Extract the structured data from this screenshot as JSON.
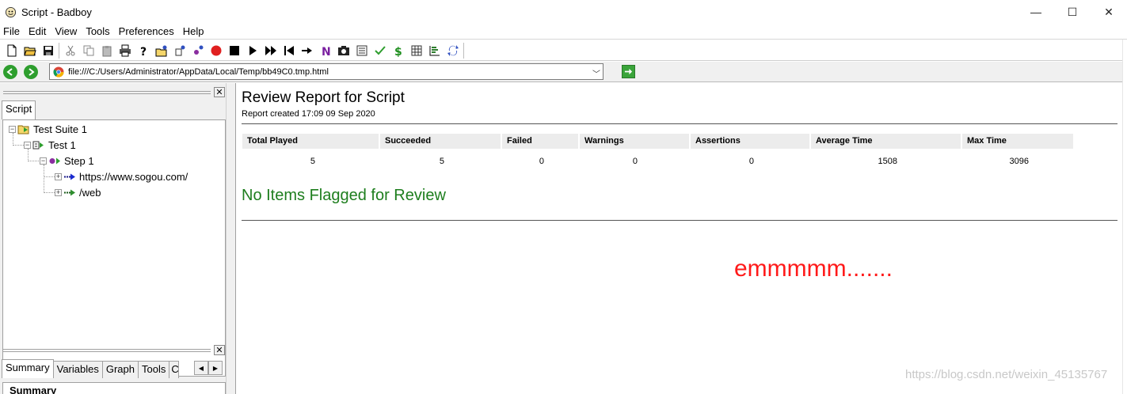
{
  "window": {
    "title": "Script - Badboy",
    "minimize": "—",
    "maximize": "☐",
    "close": "✕"
  },
  "menu": [
    "File",
    "Edit",
    "View",
    "Tools",
    "Preferences",
    "Help"
  ],
  "toolbar": {
    "icons": [
      "new-icon",
      "open-icon",
      "save-icon",
      "cut-icon",
      "copy-icon",
      "paste-icon",
      "print-icon",
      "help-icon",
      "add-suite-icon",
      "add-test-icon",
      "add-step-icon",
      "record-icon",
      "stop-icon",
      "play-icon",
      "play-all-icon",
      "rewind-icon",
      "step-icon",
      "navigation-icon",
      "screenshot-icon",
      "form-icon",
      "assertion-icon",
      "variable-icon",
      "table-icon",
      "report-icon",
      "refresh-icon"
    ]
  },
  "address": {
    "url": "file:///C:/Users/Administrator/AppData/Local/Temp/bb49C0.tmp.html"
  },
  "left_panel": {
    "top_tab": "Script",
    "tree": [
      {
        "label": "Test Suite 1",
        "level": 0
      },
      {
        "label": "Test 1",
        "level": 1
      },
      {
        "label": "Step 1",
        "level": 2
      },
      {
        "label": "https://www.sogou.com/",
        "level": 3
      },
      {
        "label": "/web",
        "level": 3
      }
    ],
    "bottom_tabs": [
      "Summary",
      "Variables",
      "Graph",
      "Tools",
      "C"
    ],
    "summary_heading": "Summary"
  },
  "report": {
    "title": "Review Report for Script",
    "subtitle": "Report created 17:09 09 Sep 2020",
    "columns": [
      "Total Played",
      "Succeeded",
      "Failed",
      "Warnings",
      "Assertions",
      "Average Time",
      "Max Time"
    ],
    "values": [
      "5",
      "5",
      "0",
      "0",
      "0",
      "1508",
      "3096"
    ],
    "flagged": "No Items Flagged for Review",
    "annotation": "emmmmm.......",
    "watermark": "https://blog.csdn.net/weixin_45135767"
  },
  "colors": {
    "flagged_green": "#1e7e1e",
    "annotation_red": "#ff1a1a",
    "record_red": "#e02020",
    "nav_green": "#2e9e2e"
  }
}
